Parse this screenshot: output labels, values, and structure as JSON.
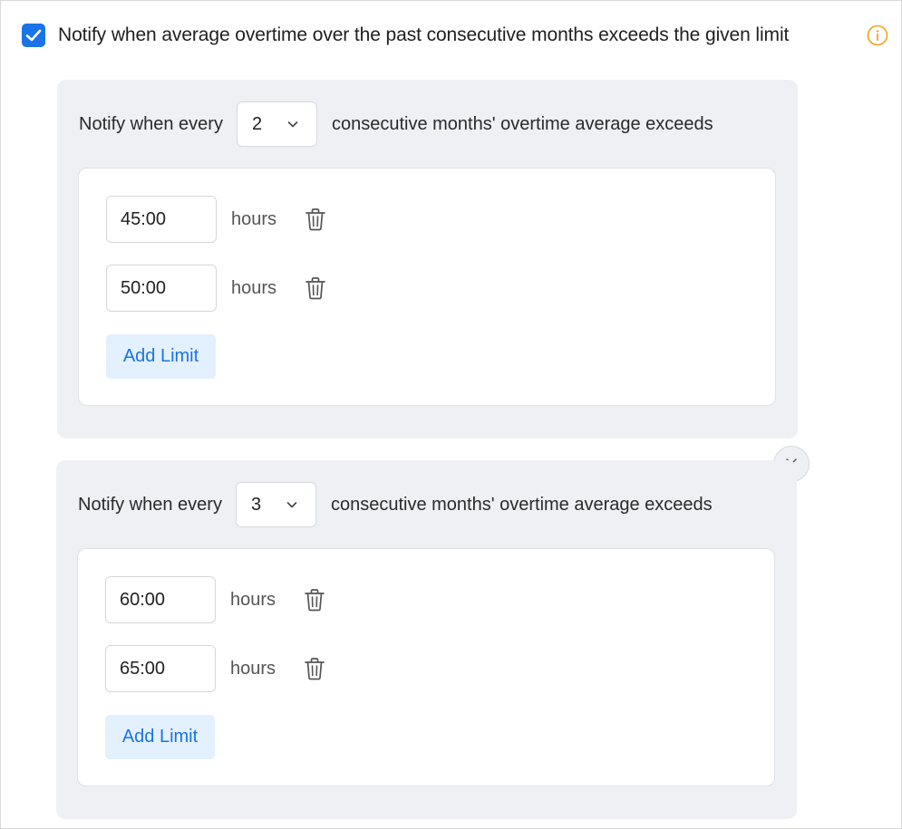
{
  "main": {
    "checked": true,
    "label": "Notify when average overtime over the past consecutive months exceeds the given limit",
    "info_icon": "info-circle-icon",
    "accent_color": "#1a73e8",
    "info_color": "#f0a21c"
  },
  "groups": [
    {
      "prefix": "Notify when every",
      "months": "2",
      "suffix": "consecutive months' overtime average exceeds",
      "limits": [
        {
          "value": "45:00",
          "unit": "hours"
        },
        {
          "value": "50:00",
          "unit": "hours"
        }
      ],
      "add_label": "Add Limit"
    },
    {
      "prefix": "Notify when every",
      "months": "3",
      "suffix": "consecutive months' overtime average exceeds",
      "limits": [
        {
          "value": "60:00",
          "unit": "hours"
        },
        {
          "value": "65:00",
          "unit": "hours"
        }
      ],
      "add_label": "Add Limit"
    }
  ]
}
